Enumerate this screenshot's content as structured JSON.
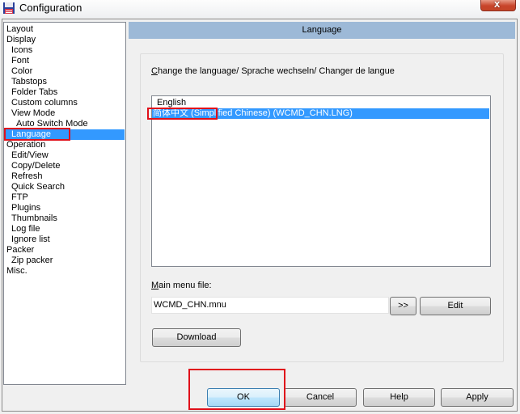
{
  "window": {
    "title": "Configuration",
    "close_label": "x"
  },
  "tree": {
    "selected": "Language",
    "items": [
      {
        "label": "Layout",
        "level": 0
      },
      {
        "label": "Display",
        "level": 0
      },
      {
        "label": "Icons",
        "level": 1
      },
      {
        "label": "Font",
        "level": 1
      },
      {
        "label": "Color",
        "level": 1
      },
      {
        "label": "Tabstops",
        "level": 1
      },
      {
        "label": "Folder Tabs",
        "level": 1
      },
      {
        "label": "Custom columns",
        "level": 1
      },
      {
        "label": "View Mode",
        "level": 1
      },
      {
        "label": "Auto Switch Mode",
        "level": 2
      },
      {
        "label": "Language",
        "level": 1
      },
      {
        "label": "Operation",
        "level": 0
      },
      {
        "label": "Edit/View",
        "level": 1
      },
      {
        "label": "Copy/Delete",
        "level": 1
      },
      {
        "label": "Refresh",
        "level": 1
      },
      {
        "label": "Quick Search",
        "level": 1
      },
      {
        "label": "FTP",
        "level": 1
      },
      {
        "label": "Plugins",
        "level": 1
      },
      {
        "label": "Thumbnails",
        "level": 1
      },
      {
        "label": "Log file",
        "level": 1
      },
      {
        "label": "Ignore list",
        "level": 1
      },
      {
        "label": "Packer",
        "level": 0
      },
      {
        "label": "Zip packer",
        "level": 1
      },
      {
        "label": "Misc.",
        "level": 0
      }
    ]
  },
  "panel": {
    "header": "Language",
    "change_language_label_first": "C",
    "change_language_label_rest": "hange the language/ Sprache wechseln/ Changer de langue",
    "languages": [
      {
        "label": "English",
        "selected": false
      },
      {
        "label": "简体中文 (Simplified Chinese) (WCMD_CHN.LNG)",
        "selected": true
      }
    ],
    "main_menu_label_first": "M",
    "main_menu_label_rest": "ain menu file:",
    "main_menu_value": "WCMD_CHN.mnu",
    "browse_label": ">>",
    "edit_label": "Edit",
    "download_label": "Download"
  },
  "footer": {
    "ok_label": "OK",
    "cancel_label": "Cancel",
    "help_label": "Help",
    "apply_label": "Apply"
  },
  "colors": {
    "selection": "#3399ff",
    "header_bg": "#9db9d7",
    "annotation_red": "#e0101a"
  }
}
